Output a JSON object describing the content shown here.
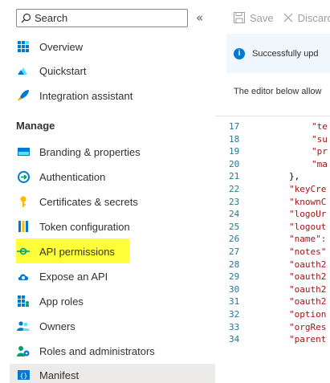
{
  "sidebar": {
    "search_placeholder": "Search",
    "collapse_label": "«",
    "items_top": [
      {
        "label": "Overview",
        "icon": "overview-grid-icon"
      },
      {
        "label": "Quickstart",
        "icon": "quickstart-cloud-icon"
      },
      {
        "label": "Integration assistant",
        "icon": "rocket-icon"
      }
    ],
    "section_manage": "Manage",
    "items_manage": [
      {
        "label": "Branding & properties",
        "icon": "branding-icon"
      },
      {
        "label": "Authentication",
        "icon": "authentication-icon"
      },
      {
        "label": "Certificates & secrets",
        "icon": "key-icon"
      },
      {
        "label": "Token configuration",
        "icon": "token-bars-icon"
      },
      {
        "label": "API permissions",
        "icon": "api-permissions-icon"
      },
      {
        "label": "Expose an API",
        "icon": "cloud-icon"
      },
      {
        "label": "App roles",
        "icon": "app-roles-grid-icon"
      },
      {
        "label": "Owners",
        "icon": "owners-icon"
      },
      {
        "label": "Roles and administrators",
        "icon": "roles-admin-icon"
      },
      {
        "label": "Manifest",
        "icon": "manifest-icon"
      }
    ]
  },
  "toolbar": {
    "save_label": "Save",
    "discard_label": "Discard"
  },
  "banner": {
    "text": "Successfully upd"
  },
  "description": "The editor below allow",
  "editor": {
    "lines": [
      {
        "num": "17",
        "text": "\"te"
      },
      {
        "num": "18",
        "text": "\"su"
      },
      {
        "num": "19",
        "text": "\"pr"
      },
      {
        "num": "20",
        "text": "\"ma"
      },
      {
        "num": "21",
        "text": "},"
      },
      {
        "num": "22",
        "text": "\"keyCre"
      },
      {
        "num": "23",
        "text": "\"knownC"
      },
      {
        "num": "24",
        "text": "\"logoUr"
      },
      {
        "num": "25",
        "text": "\"logout"
      },
      {
        "num": "26",
        "text": "\"name\":"
      },
      {
        "num": "27",
        "text": "\"notes\""
      },
      {
        "num": "28",
        "text": "\"oauth2"
      },
      {
        "num": "29",
        "text": "\"oauth2"
      },
      {
        "num": "30",
        "text": "\"oauth2"
      },
      {
        "num": "31",
        "text": "\"oauth2"
      },
      {
        "num": "32",
        "text": "\"option"
      },
      {
        "num": "33",
        "text": "\"orgRes"
      },
      {
        "num": "34",
        "text": "\"parent"
      }
    ]
  },
  "colors": {
    "highlight": "#ffff3a",
    "accent": "#0078d4",
    "line_number": "#237893",
    "string": "#a31515",
    "active_bg": "#edebe9"
  }
}
